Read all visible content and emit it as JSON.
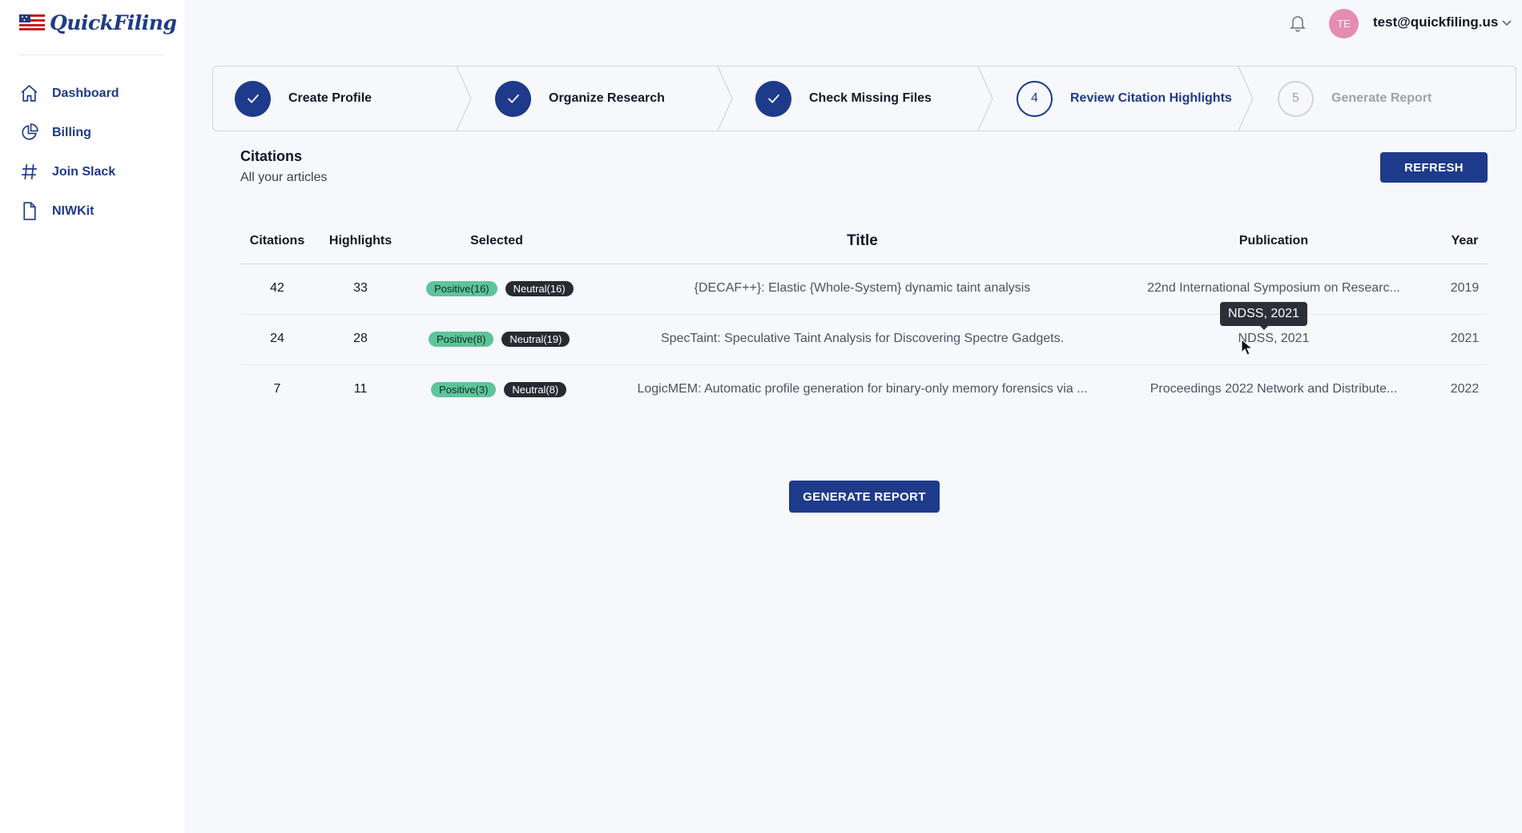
{
  "brand": {
    "name": "QuickFiling",
    "logo_icon": "us-flag-icon"
  },
  "sidebar": {
    "items": [
      {
        "label": "Dashboard",
        "icon": "home-icon"
      },
      {
        "label": "Billing",
        "icon": "pie-chart-icon"
      },
      {
        "label": "Join Slack",
        "icon": "hashtag-icon"
      },
      {
        "label": "NIWKit",
        "icon": "document-icon"
      }
    ]
  },
  "header": {
    "user_initials": "TE",
    "user_email": "test@quickfiling.us",
    "avatar_color": "#e58cb2"
  },
  "stepper": {
    "steps": [
      {
        "label": "Create Profile",
        "state": "done",
        "number": "1"
      },
      {
        "label": "Organize Research",
        "state": "done",
        "number": "2"
      },
      {
        "label": "Check Missing Files",
        "state": "done",
        "number": "3"
      },
      {
        "label": "Review Citation Highlights",
        "state": "current",
        "number": "4"
      },
      {
        "label": "Generate Report",
        "state": "future",
        "number": "5"
      }
    ]
  },
  "citations": {
    "title": "Citations",
    "subtitle": "All your articles",
    "refresh_label": "REFRESH",
    "columns": {
      "citations": "Citations",
      "highlights": "Highlights",
      "selected": "Selected",
      "title": "Title",
      "publication": "Publication",
      "year": "Year"
    },
    "rows": [
      {
        "citations": "42",
        "highlights": "33",
        "positive": "Positive(16)",
        "neutral": "Neutral(16)",
        "title": "{DECAF++}: Elastic {Whole-System} dynamic taint analysis",
        "publication": "22nd International Symposium on Researc...",
        "year": "2019"
      },
      {
        "citations": "24",
        "highlights": "28",
        "positive": "Positive(8)",
        "neutral": "Neutral(19)",
        "title": "SpecTaint: Speculative Taint Analysis for Discovering Spectre Gadgets.",
        "publication": "NDSS, 2021",
        "year": "2021"
      },
      {
        "citations": "7",
        "highlights": "11",
        "positive": "Positive(3)",
        "neutral": "Neutral(8)",
        "title": "LogicMEM: Automatic profile generation for binary-only memory forensics via ...",
        "publication": "Proceedings 2022 Network and Distribute...",
        "year": "2022"
      }
    ],
    "tooltip": "NDSS, 2021",
    "generate_label": "GENERATE REPORT"
  },
  "colors": {
    "primary": "#1e3a8a",
    "positive_badge": "#5ec49a",
    "neutral_badge": "#262b33",
    "background": "#f7f8fb"
  }
}
